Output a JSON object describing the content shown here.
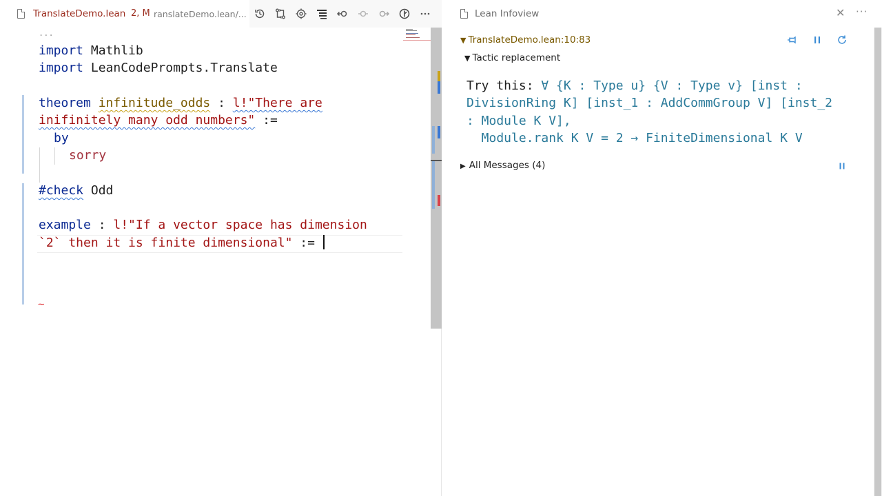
{
  "editor": {
    "tab": {
      "filename": "TranslateDemo.lean",
      "badge": "2, M",
      "path": "ranslateDemo.lean/..."
    },
    "actions": [
      {
        "name": "timeline-icon"
      },
      {
        "name": "compare-changes-icon"
      },
      {
        "name": "lean-goal-icon"
      },
      {
        "name": "infoview-toggle-icon"
      },
      {
        "name": "go-back-icon"
      },
      {
        "name": "go-forward-disabled-icon"
      },
      {
        "name": "go-forward-icon"
      },
      {
        "name": "lean-menu-icon"
      },
      {
        "name": "more-actions-icon"
      }
    ],
    "fold_indicator": "...",
    "code": {
      "l1_kw": "import",
      "l1_rest": " Mathlib",
      "l2_kw": "import",
      "l2_rest": " LeanCodePrompts.Translate",
      "l4_kw": "theorem",
      "l4_name": "infinitude_odds",
      "l4_colon": " : ",
      "l4_str": "l!\"There are",
      "l5_str": "inifinitely many odd numbers\"",
      "l5_rest": " :=",
      "l6_kw": "by",
      "l7": "sorry",
      "l9_kw": "#check",
      "l9_rest": " Odd",
      "l11_kw": "example",
      "l11_colon": " : ",
      "l11_str": "l!\"If a vector space has dimension",
      "l12_str": "`2` then it is finite dimensional\"",
      "l12_rest": " := ",
      "end_marker": "~"
    }
  },
  "infoview": {
    "title": "Lean Infoview",
    "close_glyph": "✕",
    "more_glyph": "···",
    "goal_location": "TranslateDemo.lean:10:83",
    "tactic_section": "Tactic replacement",
    "suggestion": {
      "lead": "Try this: ",
      "line1": "∀ {K : Type u} {V : Type v} [inst :",
      "line2": "DivisionRing K] [inst_1 : AddCommGroup V] [inst_2",
      "line3": ": Module K V],",
      "line4": "  Module.rank K V = 2 → FiniteDimensional K V"
    },
    "messages_section": "All Messages (4)",
    "colors": {
      "goal_header": "#7a5a00",
      "suggestion": "#2a7a9a",
      "accent": "#3c8dd6"
    }
  }
}
